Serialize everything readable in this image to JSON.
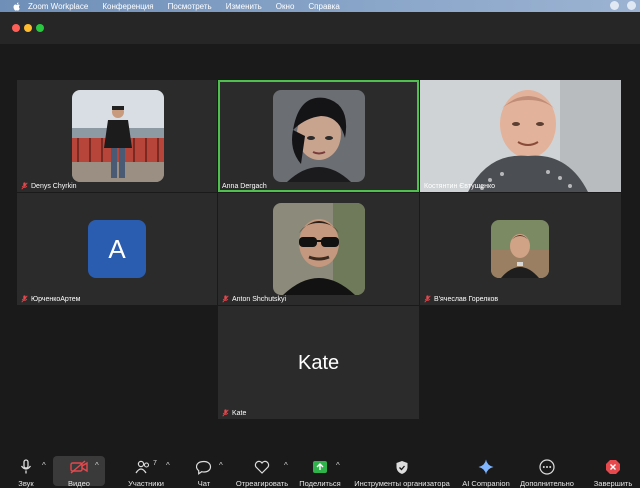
{
  "menubar": {
    "app": "Zoom Workplace",
    "items": [
      "Конференция",
      "Посмотреть",
      "Изменить",
      "Окно",
      "Справка"
    ]
  },
  "participants": [
    {
      "name": "Denys Chyrkin"
    },
    {
      "name": "Anna Dergach"
    },
    {
      "name": "Костянтин Євтушенко"
    },
    {
      "name": "ЮрченкоАртем",
      "initial": "A"
    },
    {
      "name": "Anton Shchutskyi"
    },
    {
      "name": "В'ячеслав Горелков"
    },
    {
      "name": "Kate",
      "display": "Kate"
    }
  ],
  "toolbar": {
    "audio": "Звук",
    "video": "Видео",
    "participants": "Участники",
    "participants_count": "7",
    "chat": "Чат",
    "react": "Отреагировать",
    "share": "Поделиться",
    "host_tools": "Инструменты организатора",
    "ai": "AI Companion",
    "more": "Дополнительно",
    "end": "Завершить"
  },
  "colors": {
    "active_speaker_border": "#4fbf4f",
    "avatar_bg": "#2a5db0",
    "share_green": "#2fb34a",
    "end_red": "#e5484d",
    "muted_red": "#e5484d"
  }
}
